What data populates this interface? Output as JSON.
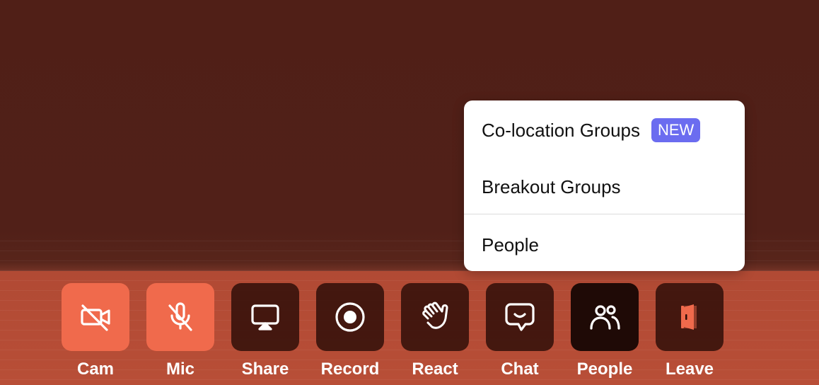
{
  "menu": {
    "items": [
      {
        "label": "Co-location Groups",
        "badge": "NEW"
      },
      {
        "label": "Breakout Groups"
      },
      {
        "label": "People"
      }
    ],
    "badge_color": "#6b6cf0"
  },
  "toolbar": {
    "buttons": [
      {
        "label": "Cam",
        "icon": "camera-off-icon",
        "state": "off"
      },
      {
        "label": "Mic",
        "icon": "mic-off-icon",
        "state": "off"
      },
      {
        "label": "Share",
        "icon": "monitor-icon",
        "state": "normal"
      },
      {
        "label": "Record",
        "icon": "record-icon",
        "state": "normal"
      },
      {
        "label": "React",
        "icon": "waving-hand-icon",
        "state": "normal"
      },
      {
        "label": "Chat",
        "icon": "chat-bubble-icon",
        "state": "normal"
      },
      {
        "label": "People",
        "icon": "people-icon",
        "state": "active"
      },
      {
        "label": "Leave",
        "icon": "door-icon",
        "state": "normal"
      }
    ],
    "off_color": "#f06a4c",
    "leave_icon_color": "#f06a4c"
  }
}
